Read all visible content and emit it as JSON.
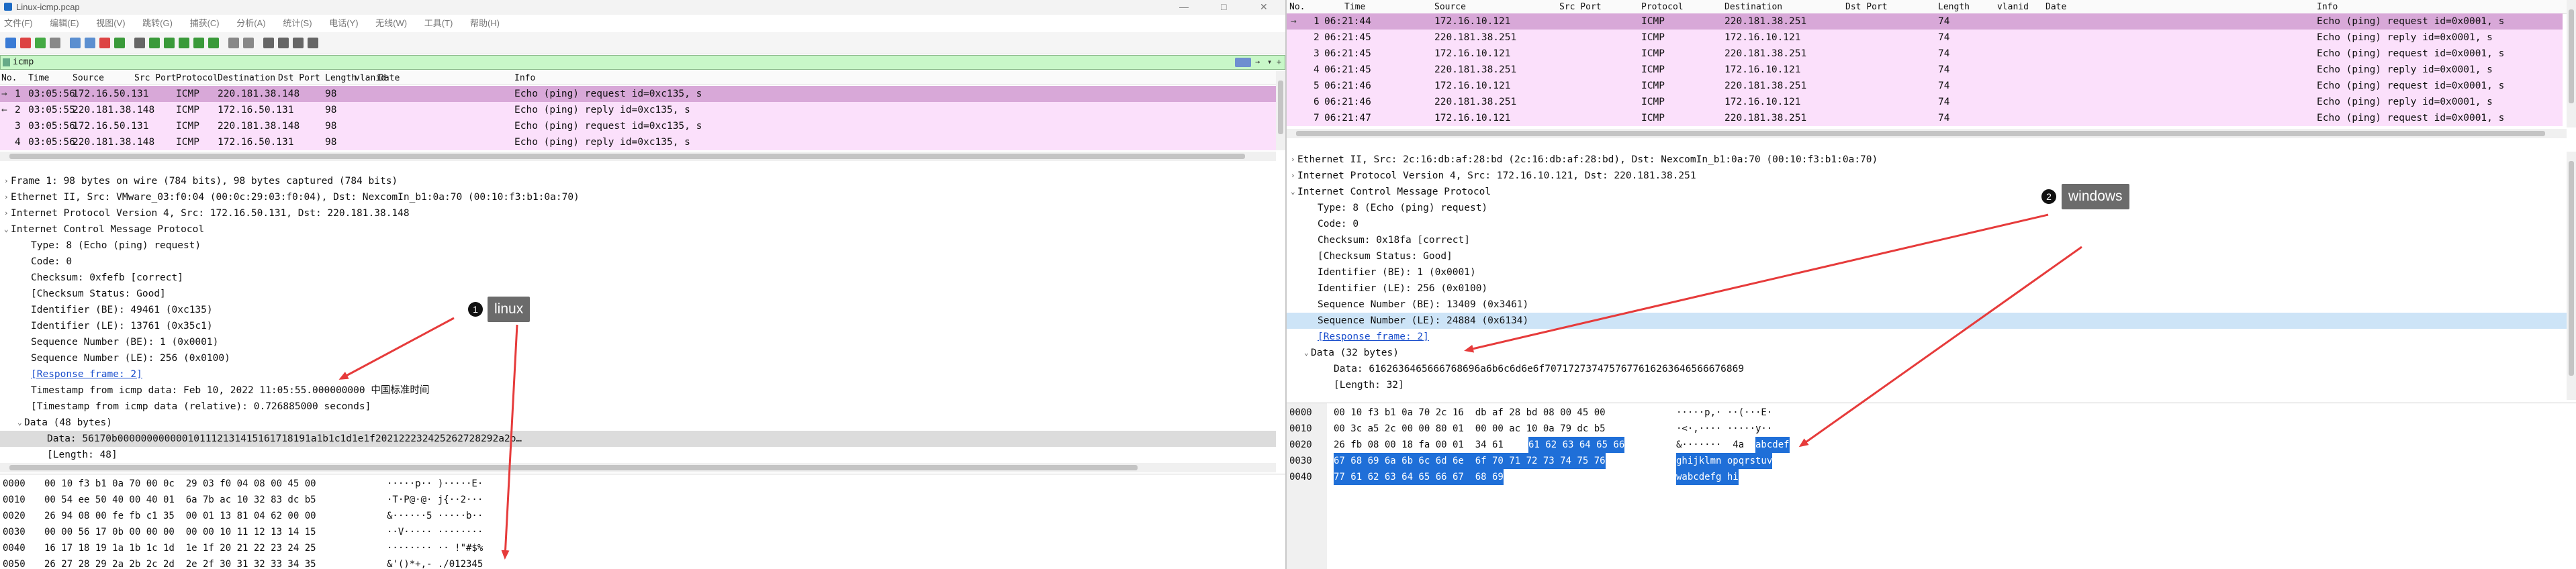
{
  "left": {
    "window_title": "Linux-icmp.pcap",
    "menu": [
      "文件(F)",
      "编辑(E)",
      "视图(V)",
      "跳转(G)",
      "捕获(C)",
      "分析(A)",
      "统计(S)",
      "电话(Y)",
      "无线(W)",
      "工具(T)",
      "帮助(H)"
    ],
    "filter": "icmp",
    "columns": [
      "No.",
      "Time",
      "Source",
      "Src Port",
      "Protocol",
      "Destination",
      "Dst Port",
      "Length",
      "vlanid",
      "Date",
      "Info"
    ],
    "packets": [
      {
        "no": "1",
        "time": "03:05:56",
        "src": "172.16.50.131",
        "proto": "ICMP",
        "dst": "220.181.38.148",
        "len": "98",
        "info": "Echo (ping) request  id=0xc135, s"
      },
      {
        "no": "2",
        "time": "03:05:55",
        "src": "220.181.38.148",
        "proto": "ICMP",
        "dst": "172.16.50.131",
        "len": "98",
        "info": "Echo (ping) reply    id=0xc135, s"
      },
      {
        "no": "3",
        "time": "03:05:56",
        "src": "172.16.50.131",
        "proto": "ICMP",
        "dst": "220.181.38.148",
        "len": "98",
        "info": "Echo (ping) request  id=0xc135, s"
      },
      {
        "no": "4",
        "time": "03:05:56",
        "src": "220.181.38.148",
        "proto": "ICMP",
        "dst": "172.16.50.131",
        "len": "98",
        "info": "Echo (ping) reply    id=0xc135, s"
      }
    ],
    "details": {
      "frame": "Frame 1: 98 bytes on wire (784 bits), 98 bytes captured (784 bits)",
      "eth": "Ethernet II, Src: VMware_03:f0:04 (00:0c:29:03:f0:04), Dst: NexcomIn_b1:0a:70 (00:10:f3:b1:0a:70)",
      "ip": "Internet Protocol Version 4, Src: 172.16.50.131, Dst: 220.181.38.148",
      "icmp": "Internet Control Message Protocol",
      "type": "Type: 8 (Echo (ping) request)",
      "code": "Code: 0",
      "checksum": "Checksum: 0xfefb [correct]",
      "checksum_status": "[Checksum Status: Good]",
      "id_be": "Identifier (BE): 49461 (0xc135)",
      "id_le": "Identifier (LE): 13761 (0x35c1)",
      "seq_be": "Sequence Number (BE): 1 (0x0001)",
      "seq_le": "Sequence Number (LE): 256 (0x0100)",
      "response": "[Response frame: 2]",
      "timestamp": "Timestamp from icmp data: Feb 10, 2022 11:05:55.000000000 中国标准时间",
      "timestamp_rel": "[Timestamp from icmp data (relative): 0.726885000 seconds]",
      "data": "Data (48 bytes)",
      "data_value": "Data: 56170b000000000000101112131415161718191a1b1c1d1e1f202122232425262728292a2b…",
      "length": "[Length: 48]"
    },
    "hex": [
      {
        "off": "0000",
        "hex": "00 10 f3 b1 0a 70 00 0c  29 03 f0 04 08 00 45 00",
        "ascii": "·····p·· )·····E·"
      },
      {
        "off": "0010",
        "hex": "00 54 ee 50 40 00 40 01  6a 7b ac 10 32 83 dc b5",
        "ascii": "·T·P@·@· j{··2···"
      },
      {
        "off": "0020",
        "hex": "26 94 08 00 fe fb c1 35  00 01 13 81 04 62 00 00",
        "ascii": "&······5 ·····b··"
      },
      {
        "off": "0030",
        "hex": "00 00 56 17 0b 00 00 00  00 00 10 11 12 13 14 15",
        "ascii": "··V····· ········"
      },
      {
        "off": "0040",
        "hex": "16 17 18 19 1a 1b 1c 1d  1e 1f 20 21 22 23 24 25",
        "ascii": "········ ·· !\"#$%"
      },
      {
        "off": "0050",
        "hex": "26 27 28 29 2a 2b 2c 2d  2e 2f 30 31 32 33 34 35",
        "ascii": "&'()*+,- ./012345"
      }
    ],
    "callout_num": "1",
    "callout_text": "linux"
  },
  "right": {
    "columns": [
      "No.",
      "Time",
      "Source",
      "Src Port",
      "Protocol",
      "Destination",
      "Dst Port",
      "Length",
      "vlanid",
      "Date",
      "Info"
    ],
    "packets": [
      {
        "no": "1",
        "time": "06:21:44",
        "src": "172.16.10.121",
        "proto": "ICMP",
        "dst": "220.181.38.251",
        "len": "74",
        "info": "Echo (ping) request  id=0x0001, s"
      },
      {
        "no": "2",
        "time": "06:21:45",
        "src": "220.181.38.251",
        "proto": "ICMP",
        "dst": "172.16.10.121",
        "len": "74",
        "info": "Echo (ping) reply    id=0x0001, s"
      },
      {
        "no": "3",
        "time": "06:21:45",
        "src": "172.16.10.121",
        "proto": "ICMP",
        "dst": "220.181.38.251",
        "len": "74",
        "info": "Echo (ping) request  id=0x0001, s"
      },
      {
        "no": "4",
        "time": "06:21:45",
        "src": "220.181.38.251",
        "proto": "ICMP",
        "dst": "172.16.10.121",
        "len": "74",
        "info": "Echo (ping) reply    id=0x0001, s"
      },
      {
        "no": "5",
        "time": "06:21:46",
        "src": "172.16.10.121",
        "proto": "ICMP",
        "dst": "220.181.38.251",
        "len": "74",
        "info": "Echo (ping) request  id=0x0001, s"
      },
      {
        "no": "6",
        "time": "06:21:46",
        "src": "220.181.38.251",
        "proto": "ICMP",
        "dst": "172.16.10.121",
        "len": "74",
        "info": "Echo (ping) reply    id=0x0001, s"
      },
      {
        "no": "7",
        "time": "06:21:47",
        "src": "172.16.10.121",
        "proto": "ICMP",
        "dst": "220.181.38.251",
        "len": "74",
        "info": "Echo (ping) request  id=0x0001, s"
      }
    ],
    "details": {
      "eth": "Ethernet II, Src: 2c:16:db:af:28:bd (2c:16:db:af:28:bd), Dst: NexcomIn_b1:0a:70 (00:10:f3:b1:0a:70)",
      "ip": "Internet Protocol Version 4, Src: 172.16.10.121, Dst: 220.181.38.251",
      "icmp": "Internet Control Message Protocol",
      "type": "Type: 8 (Echo (ping) request)",
      "code": "Code: 0",
      "checksum": "Checksum: 0x18fa [correct]",
      "checksum_status": "[Checksum Status: Good]",
      "id_be": "Identifier (BE): 1 (0x0001)",
      "id_le": "Identifier (LE): 256 (0x0100)",
      "seq_be": "Sequence Number (BE): 13409 (0x3461)",
      "seq_le": "Sequence Number (LE): 24884 (0x6134)",
      "response": "[Response frame: 2]",
      "data": "Data (32 bytes)",
      "data_value": "Data: 6162636465666768696a6b6c6d6e6f7071727374757677616263646566676869",
      "length": "[Length: 32]"
    },
    "hex": [
      {
        "off": "0000",
        "hex_a": "00 10 f3 b1 0a 70 2c 16  db af 28 bd 08 00 45 00",
        "hex_b": "",
        "ascii_a": "·····p,· ··(···E·",
        "ascii_b": ""
      },
      {
        "off": "0010",
        "hex_a": "00 3c a5 2c 00 00 80 01  00 00 ac 10 0a 79 dc b5",
        "hex_b": "",
        "ascii_a": "·<·,···· ·····y··",
        "ascii_b": ""
      },
      {
        "off": "0020",
        "hex_a": "26 fb 08 00 18 fa 00 01  34 61 ",
        "hex_b": "61 62 63 64 65 66",
        "ascii_a": "&·······  4a",
        "ascii_b": "abcdef"
      },
      {
        "off": "0030",
        "hex_a": "",
        "hex_b": "67 68 69 6a 6b 6c 6d 6e  6f 70 71 72 73 74 75 76",
        "ascii_a": "",
        "ascii_b": "ghijklmn opqrstuv"
      },
      {
        "off": "0040",
        "hex_a": "",
        "hex_b": "77 61 62 63 64 65 66 67  68 69",
        "ascii_a": "",
        "ascii_b": "wabcdefg hi"
      }
    ],
    "callout_num": "2",
    "callout_text": "windows"
  },
  "colors": {
    "selected_row": "#d8a8d8",
    "icmp_row": "#fbe0fb",
    "filter_bg": "#c8f7c8",
    "hex_selection": "#1f6fd8",
    "highlight_line": "#cde4f7",
    "arrow": "#e63b3b",
    "callout": "#6b6b6b"
  }
}
